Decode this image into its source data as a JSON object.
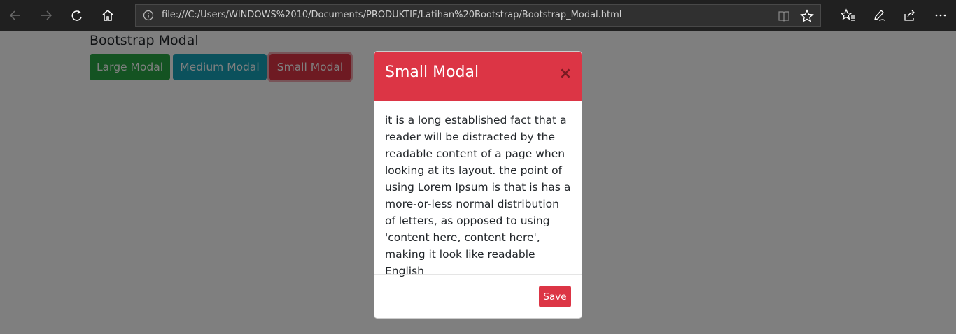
{
  "browser": {
    "url": "file:///C:/Users/WINDOWS%2010/Documents/PRODUKTIF/Latihan%20Bootstrap/Bootstrap_Modal.html",
    "icons": {
      "back": "back-arrow-icon",
      "forward": "forward-arrow-icon",
      "refresh": "refresh-icon",
      "home": "home-icon",
      "info": "info-icon",
      "reader": "reading-view-icon",
      "favorite": "star-icon",
      "favorites": "favorites-icon",
      "notes": "pen-icon",
      "share": "share-icon",
      "more": "more-icon"
    }
  },
  "page": {
    "title": "Bootstrap Modal",
    "buttons": {
      "large": "Large Modal",
      "medium": "Medium Modal",
      "small": "Small Modal"
    }
  },
  "modal": {
    "title": "Small Modal",
    "close": "×",
    "body": "it is a long established fact that a reader will be distracted by the readable content of a page when looking at its layout. the point of using Lorem Ipsum is that is has a more-or-less normal distribution of letters, as opposed to using 'content here, content here', making it look like readable English",
    "save": "Save"
  },
  "colors": {
    "success": "#28a745",
    "info": "#17a2b8",
    "danger": "#dc3545",
    "toolbar": "#202020"
  }
}
